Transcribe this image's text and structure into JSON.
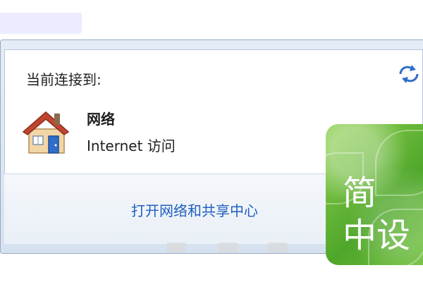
{
  "flyout": {
    "connected_label": "当前连接到:",
    "network": {
      "name": "网络",
      "access": "Internet 访问",
      "icon": "house-icon"
    },
    "refresh_icon": "refresh-arrows-icon",
    "open_center_link": "打开网络和共享中心"
  },
  "watermark": {
    "line1": "简",
    "line2": "中设"
  },
  "colors": {
    "link": "#1f5fbf",
    "frame": "#d6e1ef",
    "watermark_green": "#5db234"
  }
}
